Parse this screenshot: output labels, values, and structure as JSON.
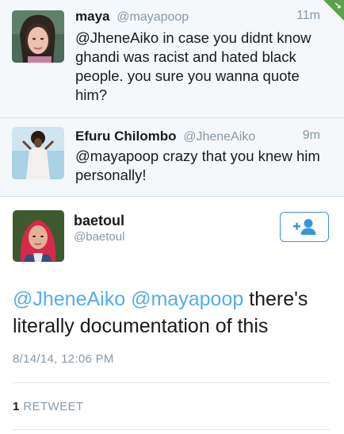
{
  "replies": [
    {
      "name": "maya",
      "handle": "@mayapoop",
      "time": "11m",
      "text_lines": [
        "@JheneAiko in case you didnt know",
        "ghandi was racist and hated black",
        "people. you sure you wanna quote",
        "him?"
      ]
    },
    {
      "name": "Efuru Chilombo",
      "handle": "@JheneAiko",
      "time": "9m",
      "text_lines": [
        "@mayapoop crazy that you knew him",
        "personally!"
      ]
    }
  ],
  "main_tweet": {
    "name": "baetoul",
    "handle": "@baetoul",
    "mention_1": "@JheneAiko",
    "mention_2": "@mayapoop",
    "text_after_mentions": " there's",
    "text_line_2": "literally documentation of this",
    "date": "8/14/14, 12:06 PM",
    "retweet_count": "1",
    "retweet_label": "RETWEET"
  },
  "colors": {
    "link": "#55acee",
    "muted": "#8899a6",
    "follow_border": "#3b94d9",
    "corner": "#5aa34a"
  },
  "icons": {
    "follow": "add-user-icon",
    "corner": "corner-arrow-icon"
  }
}
